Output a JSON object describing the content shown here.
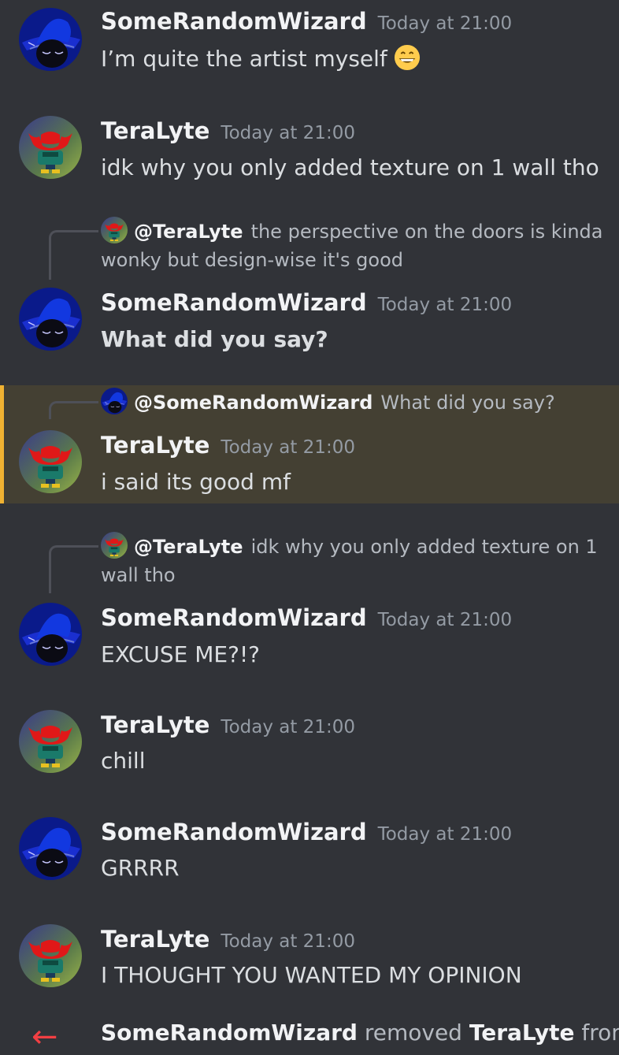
{
  "users": {
    "wizard": {
      "name": "SomeRandomWizard"
    },
    "tera": {
      "name": "TeraLyte"
    }
  },
  "messages": [
    {
      "author": "SomeRandomWizard",
      "timestamp": "Today at 21:00",
      "text": "I’m quite the artist myself",
      "emoji": "grinning-face"
    },
    {
      "author": "TeraLyte",
      "timestamp": "Today at 21:00",
      "text": "idk why you only added texture on 1 wall tho"
    },
    {
      "author": "SomeRandomWizard",
      "timestamp": "Today at 21:00",
      "text": "What did you say?",
      "reply": {
        "mention": "@TeraLyte",
        "text": "the perspective on the doors is kinda wonky but design-wise it's good"
      }
    },
    {
      "author": "TeraLyte",
      "timestamp": "Today at 21:00",
      "text": "i said its good mf",
      "highlighted": true,
      "reply": {
        "mention": "@SomeRandomWizard",
        "text": "What did you say?"
      }
    },
    {
      "author": "SomeRandomWizard",
      "timestamp": "Today at 21:00",
      "text": "EXCUSE ME?!?",
      "reply": {
        "mention": "@TeraLyte",
        "text": "idk why you only added texture on 1 wall tho"
      }
    },
    {
      "author": "TeraLyte",
      "timestamp": "Today at 21:00",
      "text": "chill"
    },
    {
      "author": "SomeRandomWizard",
      "timestamp": "Today at 21:00",
      "text": "GRRRR"
    },
    {
      "author": "TeraLyte",
      "timestamp": "Today at 21:00",
      "text": "I THOUGHT YOU WANTED MY OPINION"
    }
  ],
  "system": {
    "actor": "SomeRandomWizard",
    "action": "removed",
    "target": "TeraLyte",
    "suffix": "from"
  },
  "colors": {
    "background": "#313338",
    "highlight": "#444033",
    "highlight_bar": "#f0b232",
    "timestamp": "#949ba4",
    "remove_icon": "#f23f43"
  }
}
